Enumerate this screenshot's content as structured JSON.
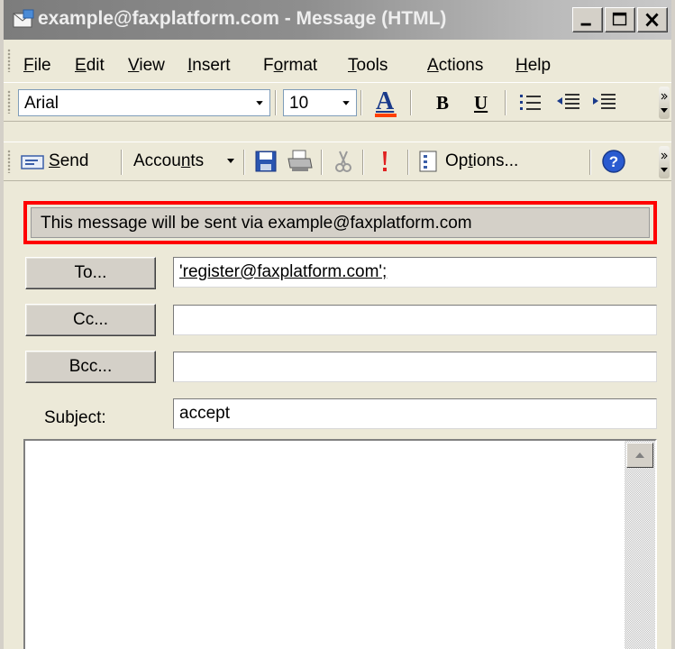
{
  "window": {
    "title": "example@faxplatform.com - Message (HTML)"
  },
  "menu": {
    "items": [
      {
        "label": "File",
        "key": "F",
        "rest": "ile"
      },
      {
        "label": "Edit",
        "key": "E",
        "rest": "dit"
      },
      {
        "label": "View",
        "key": "V",
        "rest": "iew"
      },
      {
        "label": "Insert",
        "key": "I",
        "rest": "nsert"
      },
      {
        "label": "Format",
        "pre": "F",
        "key": "o",
        "rest": "rmat"
      },
      {
        "label": "Tools",
        "key": "T",
        "rest": "ools"
      },
      {
        "label": "Actions",
        "key": "A",
        "rest": "ctions"
      },
      {
        "label": "Help",
        "key": "H",
        "rest": "elp"
      }
    ]
  },
  "format_toolbar": {
    "font": "Arial",
    "size": "10",
    "bold": "B",
    "underline": "U",
    "font_color_glyph": "A"
  },
  "standard_toolbar": {
    "send_key": "S",
    "send_rest": "end",
    "accounts_pre": "Accou",
    "accounts_key": "n",
    "accounts_rest": "ts",
    "options_pre": "Op",
    "options_key": "t",
    "options_rest": "ions..."
  },
  "info_bar": {
    "text": "This message will be sent via example@faxplatform.com"
  },
  "address": {
    "to_label": "To...",
    "to_value": "'register@faxplatform.com';",
    "cc_label": "Cc...",
    "cc_value": "",
    "bcc_label": "Bcc...",
    "bcc_value": "",
    "subject_label": "Subject:",
    "subject_value": "accept"
  },
  "body": {
    "text": ""
  },
  "colors": {
    "highlight_outline": "#ff0000",
    "font_color_bar": "#ff4000"
  }
}
